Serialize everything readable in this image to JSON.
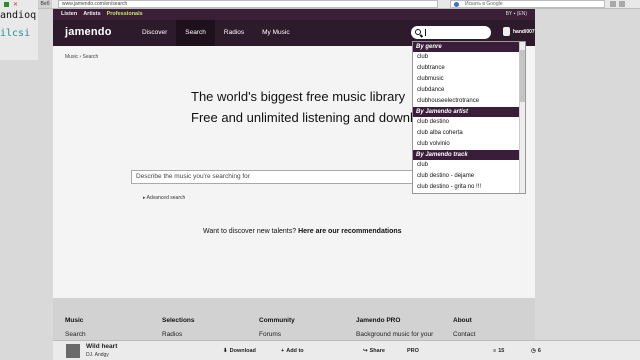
{
  "browser": {
    "chip": "Веб",
    "url": "www.jamendo.com/en/search",
    "search_placeholder": "Искать в Google"
  },
  "side_window": {
    "line1": "andioq",
    "line2": "ilcsi"
  },
  "header": {
    "top_links": [
      "Listen",
      "Artists",
      "Professionals"
    ],
    "language": "BY ▪ (EN)",
    "logo": "jamendo",
    "nav": [
      "Discover",
      "Search",
      "Radios",
      "My Music"
    ],
    "user": "handi007",
    "search_value": ""
  },
  "page": {
    "breadcrumb": "Music › Search",
    "headline1": "The world's biggest free music library",
    "headline2": "Free and unlimited listening and downloads",
    "input_placeholder": "Describe the music you're searching for",
    "advanced": "Advanced search",
    "reco_text": "Want to discover new talents?",
    "reco_link": "Here are our recommendations"
  },
  "dropdown": {
    "sections": [
      {
        "title": "By genre",
        "items": [
          "club",
          "clubtrance",
          "clubmusic",
          "clubdance",
          "clubhouseelectrotrance"
        ]
      },
      {
        "title": "By Jamendo artist",
        "items": [
          "club destino",
          "club alba coherta",
          "club volvinio"
        ]
      },
      {
        "title": "By Jamendo track",
        "items": [
          "club",
          "club destino - dejame",
          "club destino - grita no !!!"
        ]
      }
    ]
  },
  "footer": {
    "columns": [
      {
        "heading": "Music",
        "link": "Search"
      },
      {
        "heading": "Selections",
        "link": "Radios"
      },
      {
        "heading": "Community",
        "link": "Forums"
      },
      {
        "heading": "Jamendo PRO",
        "link": "Background music for your"
      },
      {
        "heading": "About",
        "link": "Contact"
      }
    ]
  },
  "player": {
    "title": "Wild heart",
    "artist": "DJ. Andgy",
    "download": "Download",
    "add": "Add to",
    "share": "Share",
    "pro": "PRO",
    "count1": "15",
    "count2": "6"
  }
}
